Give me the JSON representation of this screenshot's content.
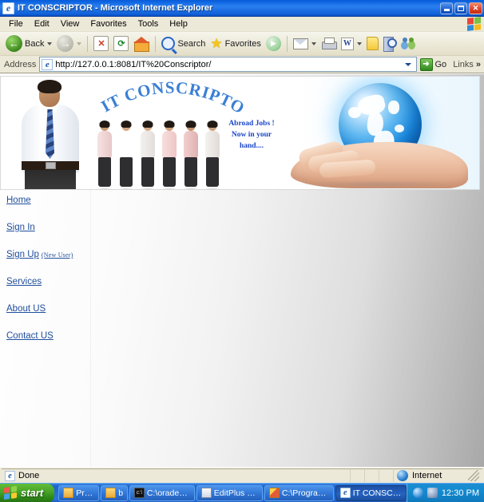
{
  "window": {
    "title": "IT CONSCRIPTOR - Microsoft Internet Explorer",
    "app_icon": "ie-icon",
    "minimize_label": "_",
    "maximize_label": "",
    "close_label": "✕"
  },
  "menubar": {
    "items": [
      "File",
      "Edit",
      "View",
      "Favorites",
      "Tools",
      "Help"
    ],
    "brand_icon": "windows-flag-icon"
  },
  "toolbar": {
    "back_label": "Back",
    "forward_label": "",
    "stop_label": "✕",
    "refresh_label": "⟳",
    "home_label": "",
    "search_label": "Search",
    "favorites_label": "Favorites",
    "media_label": "",
    "mail_label": "",
    "print_label": "",
    "edit_label": "W",
    "discuss_label": "",
    "research_label": "",
    "messenger_label": ""
  },
  "addressbar": {
    "label": "Address",
    "url": "http://127.0.0.1:8081/IT%20Conscriptor/",
    "go_label": "Go",
    "links_label": "Links",
    "chevron": "»"
  },
  "page": {
    "banner": {
      "arc_title": "IT CONSCRIPTOR",
      "slogan_line1": "Abroad Jobs !",
      "slogan_line2": "Now in your",
      "slogan_line3": "hand....",
      "man_photo_alt": "businessman-photo",
      "group_photo_alt": "professionals-group-photo",
      "globe_photo_alt": "globe-in-hand-photo",
      "title_color": "#3a7fd5",
      "slogan_color": "#1a46c8"
    },
    "nav": [
      {
        "label": "Home",
        "sub": ""
      },
      {
        "label": "Sign In",
        "sub": ""
      },
      {
        "label": "Sign Up",
        "sub": "(New User)"
      },
      {
        "label": "Services",
        "sub": ""
      },
      {
        "label": "About US",
        "sub": ""
      },
      {
        "label": "Contact US",
        "sub": ""
      }
    ],
    "link_color": "#1f4e9c"
  },
  "statusbar": {
    "message": "Done",
    "zone": "Internet"
  },
  "taskbar": {
    "start_label": "start",
    "tasks": [
      {
        "label": "Projects",
        "icon": "folder-icon",
        "active": false
      },
      {
        "label": "bin",
        "icon": "folder-icon",
        "active": false
      },
      {
        "label": "C:\\oradexe\\app...",
        "icon": "console-icon",
        "active": false
      },
      {
        "label": "EditPlus - [E:\\Pr...",
        "icon": "editplus-icon",
        "active": false
      },
      {
        "label": "C:\\Program Files...",
        "icon": "pencil-icon",
        "active": false
      },
      {
        "label": "IT CONSCRIPTO...",
        "icon": "ie-icon",
        "active": true
      }
    ],
    "clock": "12:30 PM"
  }
}
